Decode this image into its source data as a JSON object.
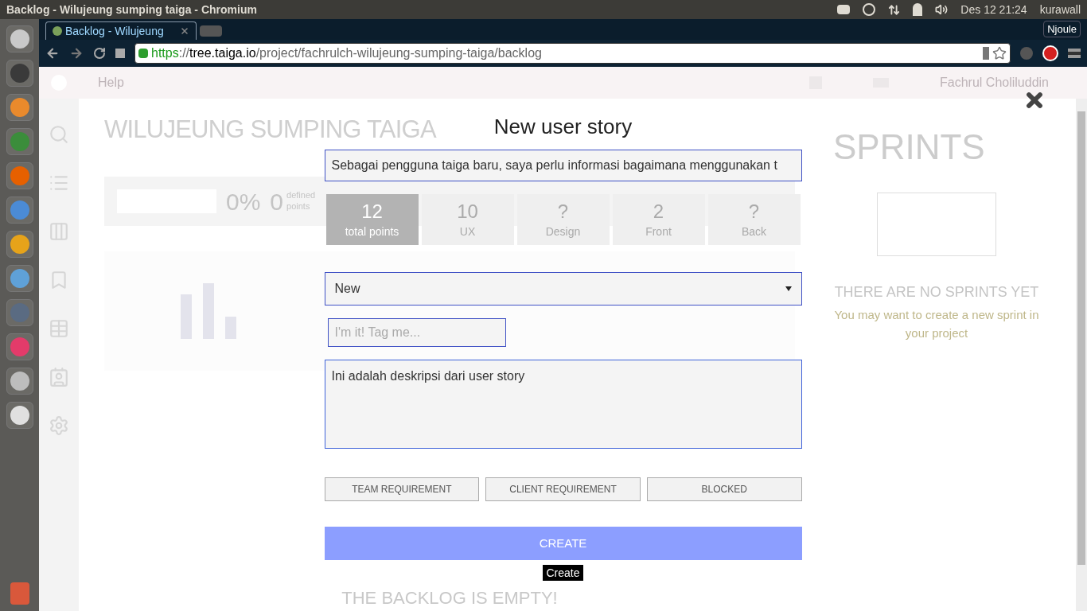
{
  "os_bar": {
    "title": "Backlog - Wilujeung sumping taiga - Chromium",
    "clock": "Des 12 21:24",
    "user": "kurawall"
  },
  "browser": {
    "tab": "Backlog - Wilujeung",
    "profile": "Njoule",
    "url_scheme": "https",
    "url_sep": "://",
    "url_host": "tree.taiga.io",
    "url_path": "/project/fachrulch-wilujeung-sumping-taiga/backlog"
  },
  "page": {
    "nav_help": "Help",
    "user_name": "Fachrul Choliluddin",
    "title": "WILUJEUNG SUMPING TAIGA",
    "progress": {
      "level": 0
    },
    "stats": [
      {
        "value": "0%"
      },
      {
        "value": "0",
        "label": "defined points"
      }
    ],
    "sprints_title": "SPRINTS",
    "sprints_empty": "THERE ARE NO SPRINTS YET",
    "sprints_hint": "You may want to create a new sprint in your project",
    "backlog_empty": "THE BACKLOG IS EMPTY!"
  },
  "modal": {
    "title": "New user story",
    "subject": "Sebagai pengguna taiga baru, saya perlu informasi bagaimana menggunakan t",
    "points": [
      {
        "value": "12",
        "label": "total points",
        "selected": true
      },
      {
        "value": "10",
        "label": "UX",
        "selected": false
      },
      {
        "value": "?",
        "label": "Design",
        "selected": false
      },
      {
        "value": "2",
        "label": "Front",
        "selected": false
      },
      {
        "value": "?",
        "label": "Back",
        "selected": false
      }
    ],
    "status": "New",
    "tag_placeholder": "I'm it! Tag me...",
    "description": "Ini adalah deskripsi dari user story",
    "flags": [
      {
        "label": "TEAM REQUIREMENT",
        "selected": false
      },
      {
        "label": "CLIENT REQUIREMENT",
        "selected": false
      },
      {
        "label": "BLOCKED",
        "selected": false
      }
    ],
    "create": "CREATE",
    "tooltip": "Create"
  }
}
